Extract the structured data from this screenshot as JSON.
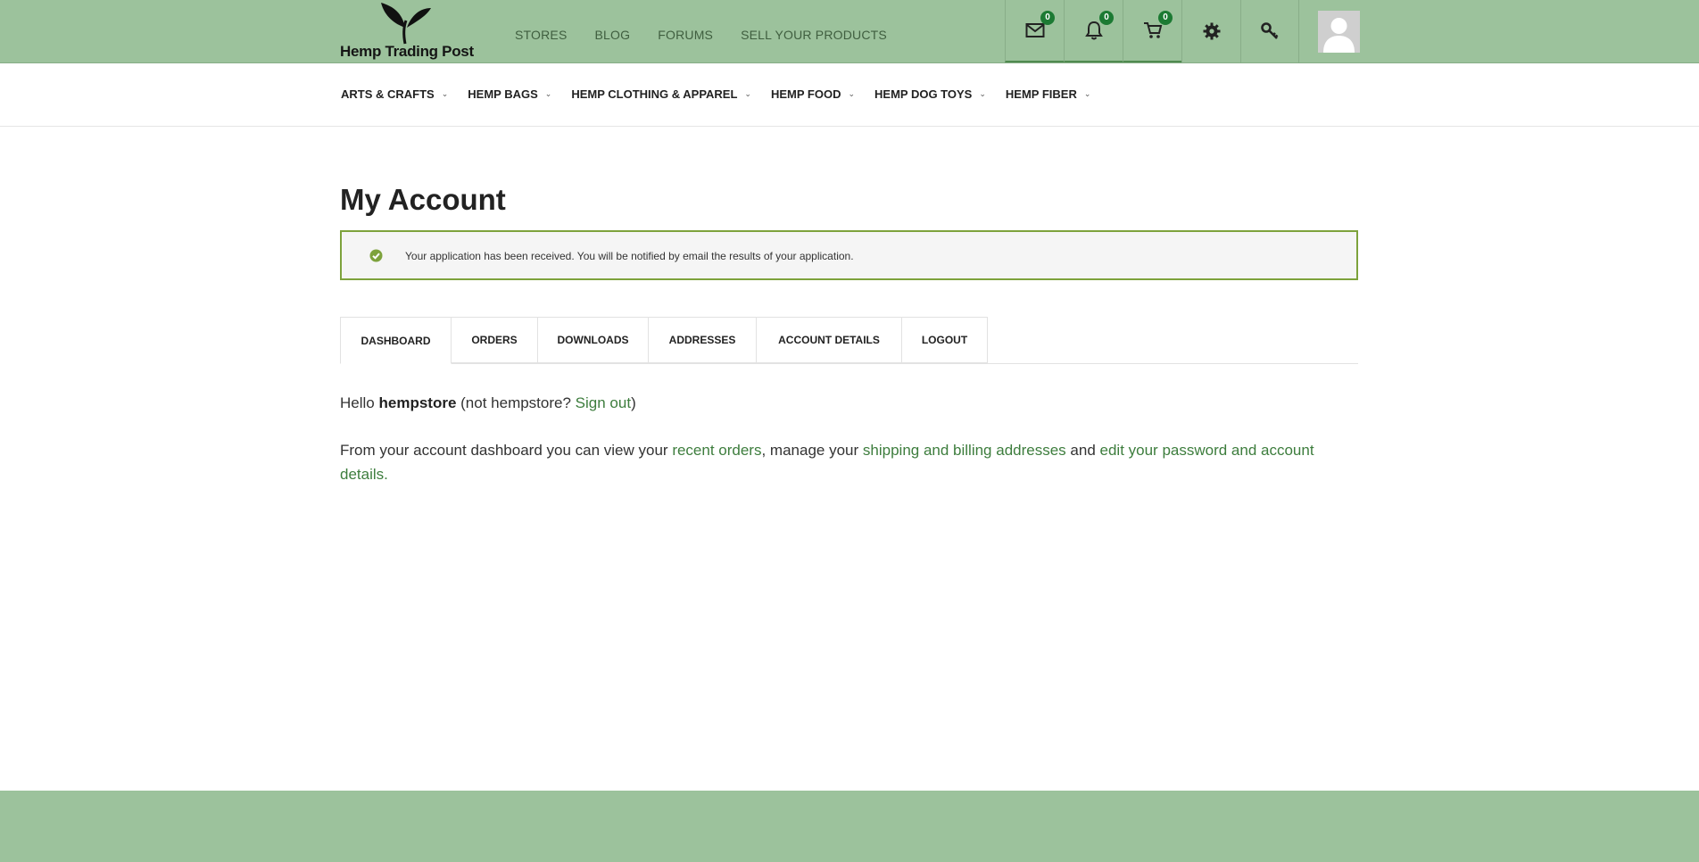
{
  "header": {
    "logo_text": "Hemp Trading Post",
    "nav": [
      {
        "label": "STORES"
      },
      {
        "label": "BLOG"
      },
      {
        "label": "FORUMS"
      },
      {
        "label": "SELL YOUR PRODUCTS"
      }
    ],
    "icons": {
      "messages": {
        "icon": "envelope-icon",
        "count": "0"
      },
      "notifications": {
        "icon": "bell-icon",
        "count": "0"
      },
      "cart": {
        "icon": "cart-icon",
        "count": "0"
      },
      "settings": {
        "icon": "gear-icon"
      },
      "login": {
        "icon": "key-icon"
      }
    },
    "avatar": "user-avatar-icon"
  },
  "categories": [
    {
      "label": "ARTS & CRAFTS"
    },
    {
      "label": "HEMP BAGS"
    },
    {
      "label": "HEMP CLOTHING & APPAREL"
    },
    {
      "label": "HEMP FOOD"
    },
    {
      "label": "HEMP DOG TOYS"
    },
    {
      "label": "HEMP FIBER"
    }
  ],
  "page": {
    "title": "My Account",
    "notice": "Your application has been received. You will be notified by email the results of your application.",
    "tabs": [
      {
        "label": "DASHBOARD",
        "active": true
      },
      {
        "label": "ORDERS"
      },
      {
        "label": "DOWNLOADS"
      },
      {
        "label": "ADDRESSES"
      },
      {
        "label": "ACCOUNT DETAILS"
      },
      {
        "label": "LOGOUT"
      }
    ],
    "greeting": {
      "hello": "Hello",
      "username": "hempstore",
      "not_prefix": "(not hempstore?",
      "signout": "Sign out",
      "close": ")"
    },
    "dashboard_text": {
      "intro": "From your account dashboard you can view your",
      "orders_link": "recent orders",
      "mid1": ", manage your",
      "addresses_link": "shipping and billing addresses",
      "mid2": "and",
      "details_link": "edit your password and account details",
      "end": "."
    }
  },
  "colors": {
    "header_bg": "#9cc29c",
    "link": "#3d7d3d",
    "notice_border": "#7da23c",
    "badge": "#1c7a33"
  }
}
